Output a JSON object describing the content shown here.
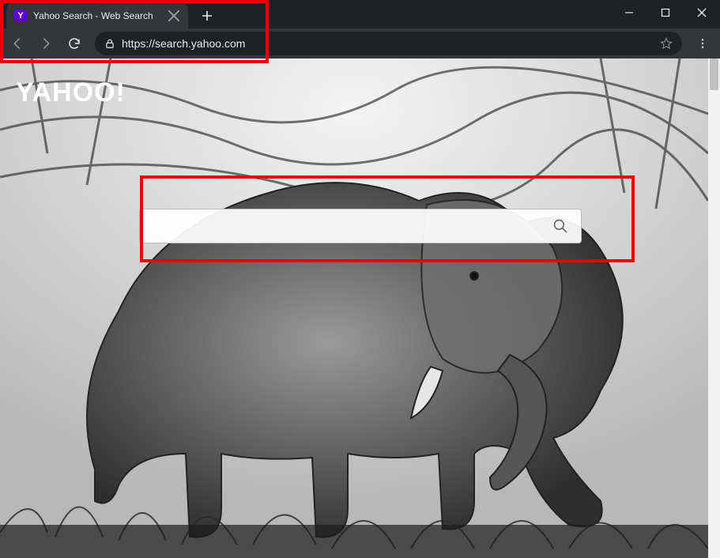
{
  "window": {
    "tab_title": "Yahoo Search - Web Search",
    "favicon_letter": "Y"
  },
  "toolbar": {
    "url": "https://search.yahoo.com"
  },
  "page": {
    "logo_text": "YAHOO!",
    "search_placeholder": ""
  },
  "icons": {
    "minimize": "minimize",
    "maximize": "maximize",
    "close": "close",
    "back": "back",
    "forward": "forward",
    "reload": "reload",
    "lock": "lock",
    "star": "star",
    "menu": "menu",
    "search": "search",
    "newtab": "+"
  }
}
